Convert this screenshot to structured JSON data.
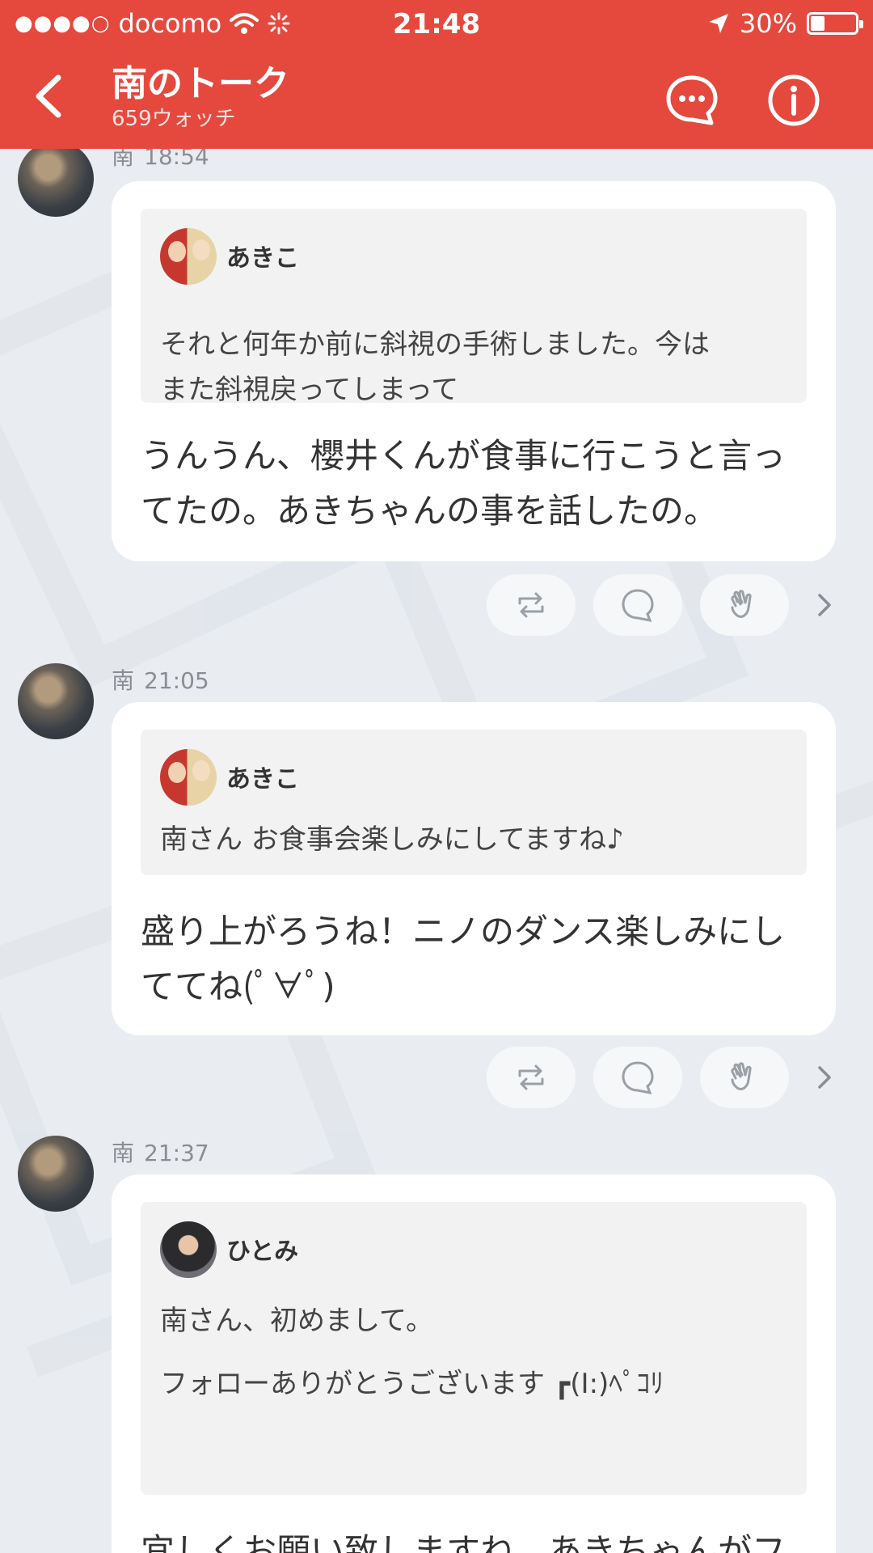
{
  "status_bar": {
    "signal": "●●●●○",
    "carrier": "docomo",
    "time": "21:48",
    "battery_text": "30%",
    "battery_level": 0.3
  },
  "header": {
    "title": "南のトーク",
    "subtitle": "659ウォッチ",
    "back_icon": "chevron-left-icon",
    "chat_icon": "chat-bubble-icon",
    "info_icon": "info-icon"
  },
  "colors": {
    "header": "#e5493d",
    "background": "#e9edf2",
    "bubble": "#ffffff",
    "quote": "#f2f2f3"
  },
  "messages": [
    {
      "sender": "南",
      "time": "18:54",
      "quote": {
        "name": "あきこ",
        "text": "それと何年か前に斜視の手術しました。今は\nまた斜視戻ってしまって"
      },
      "text": "うんうん、櫻井くんが食事に行こうと言ってたの。あきちゃんの事を話したの。"
    },
    {
      "sender": "南",
      "time": "21:05",
      "quote": {
        "name": "あきこ",
        "text": "南さん お食事会楽しみにしてますね♪"
      },
      "text": "盛り上がろうね！ニノのダンス楽しみにしててね(ﾟ∀ﾟ)"
    },
    {
      "sender": "南",
      "time": "21:37",
      "quote": {
        "name": "ひとみ",
        "text": "南さん、初めまして。\nフォローありがとうございます ┏(I:)ﾍﾟｺﾘ"
      },
      "text": "宜しくお願い致しますね。あきちゃんがフ"
    }
  ]
}
